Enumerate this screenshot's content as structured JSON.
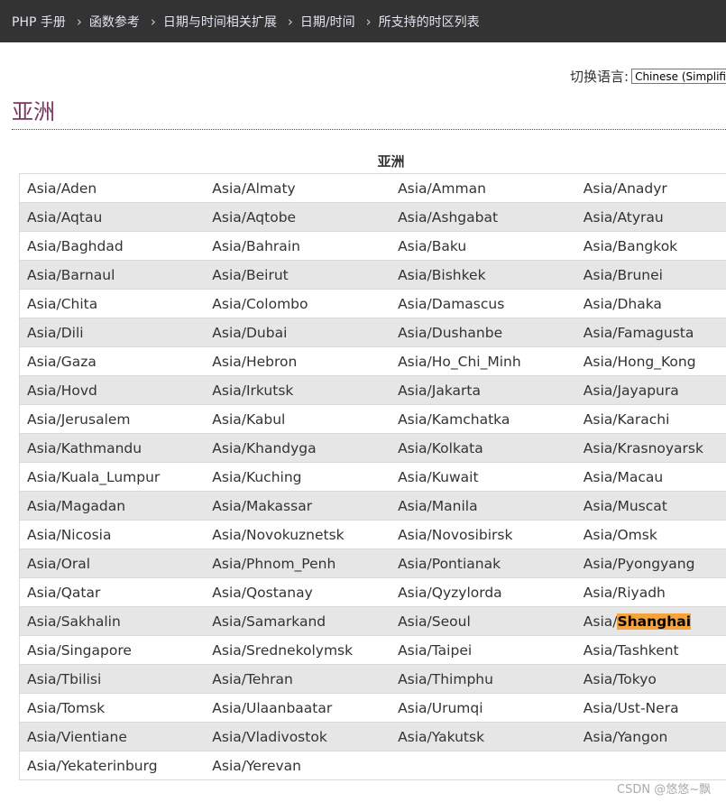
{
  "breadcrumb": [
    "PHP 手册",
    "函数参考",
    "日期与时间相关扩展",
    "日期/时间",
    "所支持的时区列表"
  ],
  "language": {
    "label": "切换语言:",
    "selected": "Chinese (Simplified)"
  },
  "heading": "亚洲",
  "table": {
    "caption": "亚洲",
    "rows": [
      [
        "Asia/Aden",
        "Asia/Almaty",
        "Asia/Amman",
        "Asia/Anadyr"
      ],
      [
        "Asia/Aqtau",
        "Asia/Aqtobe",
        "Asia/Ashgabat",
        "Asia/Atyrau"
      ],
      [
        "Asia/Baghdad",
        "Asia/Bahrain",
        "Asia/Baku",
        "Asia/Bangkok"
      ],
      [
        "Asia/Barnaul",
        "Asia/Beirut",
        "Asia/Bishkek",
        "Asia/Brunei"
      ],
      [
        "Asia/Chita",
        "Asia/Colombo",
        "Asia/Damascus",
        "Asia/Dhaka"
      ],
      [
        "Asia/Dili",
        "Asia/Dubai",
        "Asia/Dushanbe",
        "Asia/Famagusta"
      ],
      [
        "Asia/Gaza",
        "Asia/Hebron",
        "Asia/Ho_Chi_Minh",
        "Asia/Hong_Kong"
      ],
      [
        "Asia/Hovd",
        "Asia/Irkutsk",
        "Asia/Jakarta",
        "Asia/Jayapura"
      ],
      [
        "Asia/Jerusalem",
        "Asia/Kabul",
        "Asia/Kamchatka",
        "Asia/Karachi"
      ],
      [
        "Asia/Kathmandu",
        "Asia/Khandyga",
        "Asia/Kolkata",
        "Asia/Krasnoyarsk"
      ],
      [
        "Asia/Kuala_Lumpur",
        "Asia/Kuching",
        "Asia/Kuwait",
        "Asia/Macau"
      ],
      [
        "Asia/Magadan",
        "Asia/Makassar",
        "Asia/Manila",
        "Asia/Muscat"
      ],
      [
        "Asia/Nicosia",
        "Asia/Novokuznetsk",
        "Asia/Novosibirsk",
        "Asia/Omsk"
      ],
      [
        "Asia/Oral",
        "Asia/Phnom_Penh",
        "Asia/Pontianak",
        "Asia/Pyongyang"
      ],
      [
        "Asia/Qatar",
        "Asia/Qostanay",
        "Asia/Qyzylorda",
        "Asia/Riyadh"
      ],
      [
        "Asia/Sakhalin",
        "Asia/Samarkand",
        "Asia/Seoul",
        "Asia/Shanghai"
      ],
      [
        "Asia/Singapore",
        "Asia/Srednekolymsk",
        "Asia/Taipei",
        "Asia/Tashkent"
      ],
      [
        "Asia/Tbilisi",
        "Asia/Tehran",
        "Asia/Thimphu",
        "Asia/Tokyo"
      ],
      [
        "Asia/Tomsk",
        "Asia/Ulaanbaatar",
        "Asia/Urumqi",
        "Asia/Ust-Nera"
      ],
      [
        "Asia/Vientiane",
        "Asia/Vladivostok",
        "Asia/Yakutsk",
        "Asia/Yangon"
      ],
      [
        "Asia/Yekaterinburg",
        "Asia/Yerevan",
        "",
        ""
      ]
    ],
    "highlight": {
      "text": "Shanghai",
      "color": "#f5a33b"
    }
  },
  "watermark": "CSDN @悠悠~飘",
  "colors": {
    "topbar": "#333333",
    "heading": "#793862",
    "row_alt": "#e6e6e6"
  }
}
